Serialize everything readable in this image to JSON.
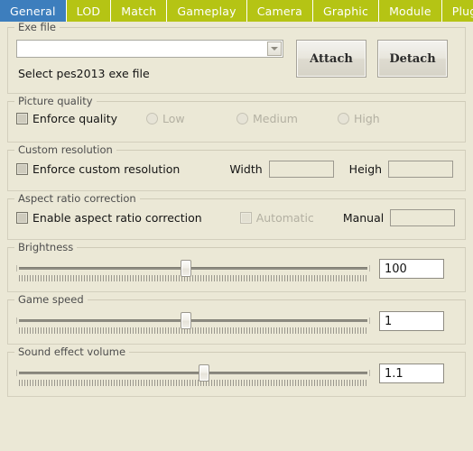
{
  "tabs": [
    {
      "label": "General",
      "active": true
    },
    {
      "label": "LOD",
      "active": false
    },
    {
      "label": "Match",
      "active": false
    },
    {
      "label": "Gameplay",
      "active": false
    },
    {
      "label": "Camera",
      "active": false
    },
    {
      "label": "Graphic",
      "active": false
    },
    {
      "label": "Module",
      "active": false
    },
    {
      "label": "Plugin",
      "active": false
    }
  ],
  "colors": {
    "tab_inactive": "#b5c414",
    "tab_active": "#3d7ebd",
    "background": "#ebe8d6",
    "group_border": "#d3cfbd",
    "disabled_text": "#b3b0a2"
  },
  "exe_file": {
    "title": "Exe file",
    "combo_value": "",
    "combo_placeholder": "",
    "hint": "Select pes2013 exe file",
    "attach_label": "Attach",
    "detach_label": "Detach"
  },
  "picture_quality": {
    "title": "Picture quality",
    "enforce_label": "Enforce quality",
    "enforce_checked": false,
    "options": [
      {
        "label": "Low",
        "selected": false,
        "disabled": true
      },
      {
        "label": "Medium",
        "selected": false,
        "disabled": true
      },
      {
        "label": "High",
        "selected": false,
        "disabled": true
      }
    ]
  },
  "custom_resolution": {
    "title": "Custom resolution",
    "enforce_label": "Enforce custom resolution",
    "enforce_checked": false,
    "width_label": "Width",
    "width_value": "",
    "height_label": "Heigh",
    "height_value": ""
  },
  "aspect_ratio": {
    "title": "Aspect ratio correction",
    "enable_label": "Enable aspect ratio correction",
    "enable_checked": false,
    "automatic_label": "Automatic",
    "automatic_checked": false,
    "manual_label": "Manual",
    "manual_value": ""
  },
  "brightness": {
    "title": "Brightness",
    "value": "100",
    "thumb_percent": 48
  },
  "game_speed": {
    "title": "Game speed",
    "value": "1",
    "thumb_percent": 48
  },
  "sound_effect_volume": {
    "title": "Sound effect volume",
    "value": "1.1",
    "thumb_percent": 53
  }
}
